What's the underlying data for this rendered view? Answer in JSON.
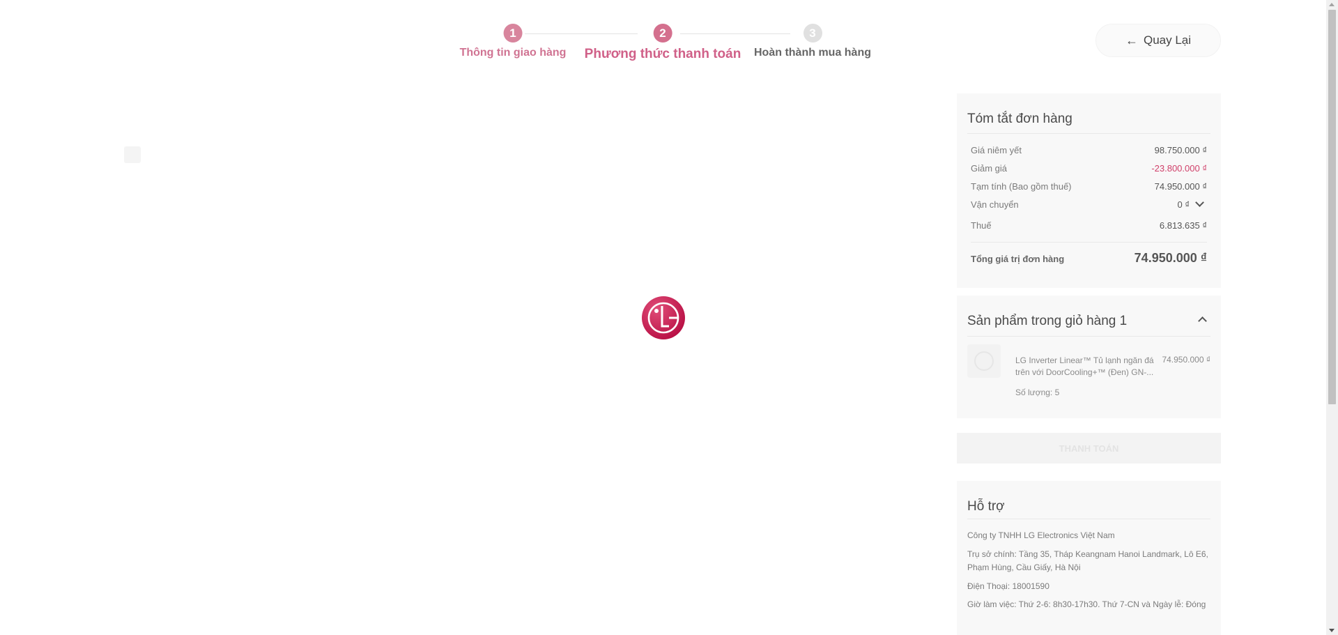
{
  "stepper": {
    "steps": [
      {
        "number": "1",
        "label": "Thông tin giao hàng",
        "state": "done"
      },
      {
        "number": "2",
        "label": "Phương thức thanh toán",
        "state": "active"
      },
      {
        "number": "3",
        "label": "Hoàn thành mua hàng",
        "state": "pending"
      }
    ]
  },
  "back_button": {
    "label": "Quay Lại",
    "icon": "arrow-left-icon"
  },
  "order_summary": {
    "title": "Tóm tắt đơn hàng",
    "rows": [
      {
        "label": "Giá niêm yết",
        "value": "98.750.000 ₫"
      },
      {
        "label": "Giảm giá",
        "value": "-23.800.000 ₫"
      },
      {
        "label": "Tạm tính (Bao gồm thuế)",
        "value": "74.950.000 ₫"
      },
      {
        "label": "Vận chuyển",
        "value": "0 ₫"
      },
      {
        "label": "Thuế",
        "value": "6.813.635 ₫"
      }
    ],
    "total_label": "Tổng giá trị đơn hàng",
    "total_value": "74.950.000 ₫"
  },
  "cart": {
    "title": "Sản phẩm trong giỏ hàng 1",
    "item": {
      "name": "LG Inverter Linear™ Tủ lạnh ngăn đá trên với DoorCooling+™ (Đen) GN-...",
      "price": "74.950.000 ₫",
      "quantity": "Số lượng: 5"
    }
  },
  "pay_button": {
    "label": "THANH TOÁN"
  },
  "support": {
    "title": "Hỗ trợ",
    "lines": [
      "Công ty TNHH LG Electronics Việt Nam",
      "Trụ sở chính: Tầng 35, Tháp Keangnam Hanoi Landmark, Lô E6, Phạm Hùng, Cầu Giấy, Hà Nội",
      "Điện Thoại: 18001590",
      "Giờ làm việc: Thứ 2-6: 8h30-17h30. Thứ 7-CN và Ngày lễ: Đóng"
    ]
  },
  "colors": {
    "accent": "#d0406a",
    "step_done": "#d8859d",
    "step_active": "#d4708e",
    "step_pending": "#e0e0e0",
    "logo": "#c6134b"
  }
}
